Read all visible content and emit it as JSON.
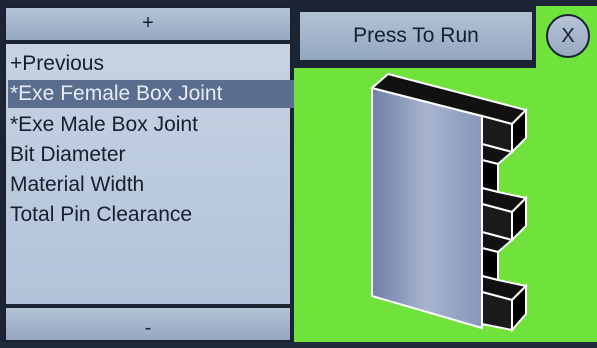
{
  "nav": {
    "up_label": "+",
    "down_label": "-"
  },
  "menu": {
    "items": [
      {
        "label": "+Previous",
        "selected": false
      },
      {
        "label": "*Exe Female Box Joint",
        "selected": true
      },
      {
        "label": "*Exe Male Box Joint",
        "selected": false
      },
      {
        "label": " Bit Diameter",
        "selected": false
      },
      {
        "label": " Material Width",
        "selected": false
      },
      {
        "label": " Total Pin Clearance",
        "selected": false
      }
    ]
  },
  "actions": {
    "run_label": "Press To Run",
    "close_label": "X"
  },
  "colors": {
    "preview_bg": "#6fe23c",
    "selected_bg": "#5a6d8f",
    "panel_bg": "#c7d3e4"
  },
  "preview": {
    "image": "female-box-joint-icon"
  }
}
